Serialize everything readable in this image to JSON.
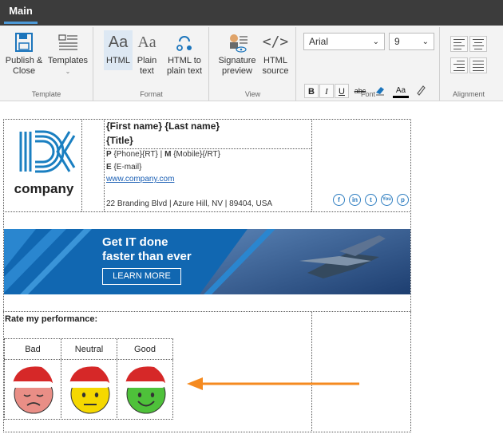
{
  "window": {
    "tab_label": "Main"
  },
  "ribbon": {
    "groups": {
      "template": "Template",
      "format": "Format",
      "view": "View",
      "font": "Font",
      "alignment": "Alignment"
    },
    "buttons": {
      "publish_close": [
        "Publish &",
        "Close"
      ],
      "templates": "Templates",
      "html": "HTML",
      "plain_text": [
        "Plain",
        "text"
      ],
      "html_to_plain": [
        "HTML to",
        "plain text"
      ],
      "signature_preview": [
        "Signature",
        "preview"
      ],
      "html_source": [
        "HTML",
        "source"
      ]
    },
    "font_name": "Arial",
    "font_size": "9",
    "format_buttons": {
      "bold": "B",
      "italic": "I",
      "underline": "U",
      "strike": "abc",
      "font_color": "Aa"
    }
  },
  "signature": {
    "logo_text": "company",
    "name_line": "{First name} {Last name}",
    "title_line": "{Title}",
    "phone_label": "P",
    "phone_value": "{Phone}{RT}",
    "separator": "|",
    "mobile_label": "M",
    "mobile_value": "{Mobile}{/RT}",
    "email_label": "E",
    "email_value": "{E-mail}",
    "website": "www.company.com",
    "address": "22 Branding Blvd | Azure Hill, NV | 89404, USA",
    "social_icons": [
      "facebook-icon",
      "linkedin-icon",
      "twitter-icon",
      "youtube-icon",
      "pinterest-icon"
    ]
  },
  "banner": {
    "headline_1": "Get IT done",
    "headline_2": "faster than ever",
    "cta_label": "LEARN MORE",
    "bg_color": "#1167b1"
  },
  "rating": {
    "prompt": "Rate my performance:",
    "options": [
      {
        "label": "Bad",
        "face_color": "#e98e86"
      },
      {
        "label": "Neutral",
        "face_color": "#f5d800"
      },
      {
        "label": "Good",
        "face_color": "#4ec13a"
      }
    ]
  },
  "annotation": {
    "arrow_color": "#f58a1f"
  }
}
